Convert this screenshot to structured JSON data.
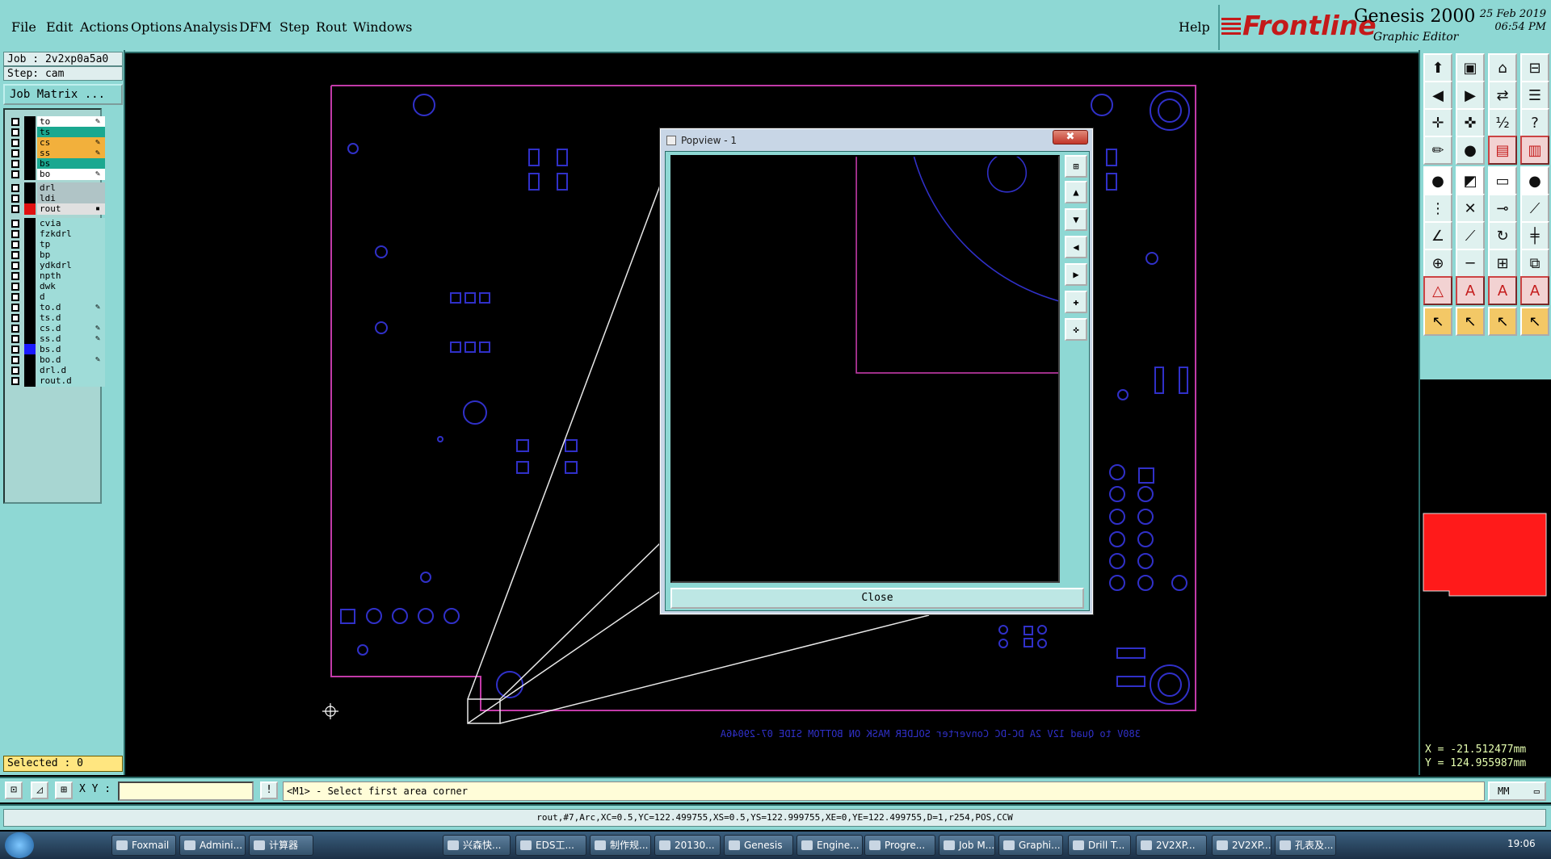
{
  "menubar": {
    "items": [
      "File",
      "Edit",
      "Actions",
      "Options",
      "Analysis",
      "DFM",
      "Step",
      "Rout",
      "Windows"
    ],
    "help": "Help"
  },
  "brand": {
    "logo": "Frontline",
    "product": "Genesis 2000",
    "subtitle": "Graphic Editor",
    "date": "25 Feb 2019",
    "time": "06:54 PM"
  },
  "left": {
    "job": "Job : 2v2xp0a5a0",
    "step": "Step: cam",
    "job_matrix": "Job Matrix ...",
    "layers": [
      {
        "name": "to",
        "color": "#ffffff",
        "swatch": "#000000",
        "flag": "✎"
      },
      {
        "name": "ts",
        "color": "#1aa890",
        "swatch": "#000000",
        "flag": ""
      },
      {
        "name": "cs",
        "color": "#f2b03c",
        "swatch": "#000000",
        "flag": "✎"
      },
      {
        "name": "ss",
        "color": "#f2b03c",
        "swatch": "#000000",
        "flag": "✎"
      },
      {
        "name": "bs",
        "color": "#1aa890",
        "swatch": "#000000",
        "flag": ""
      },
      {
        "name": "bo",
        "color": "#ffffff",
        "swatch": "#000000",
        "flag": "✎"
      },
      {
        "name": "drl",
        "color": "#b0c4c6",
        "swatch": "#000000",
        "flag": ""
      },
      {
        "name": "ldi",
        "color": "#b0c4c6",
        "swatch": "#000000",
        "flag": ""
      },
      {
        "name": "rout",
        "color": "#e0e0e0",
        "swatch": "#e01010",
        "flag": "▪"
      },
      {
        "name": "cvia",
        "color": "#9fdcd8",
        "swatch": "#000000",
        "flag": ""
      },
      {
        "name": "fzkdrl",
        "color": "#9fdcd8",
        "swatch": "#000000",
        "flag": ""
      },
      {
        "name": "tp",
        "color": "#9fdcd8",
        "swatch": "#000000",
        "flag": ""
      },
      {
        "name": "bp",
        "color": "#9fdcd8",
        "swatch": "#000000",
        "flag": ""
      },
      {
        "name": "ydkdrl",
        "color": "#9fdcd8",
        "swatch": "#000000",
        "flag": ""
      },
      {
        "name": "npth",
        "color": "#9fdcd8",
        "swatch": "#000000",
        "flag": ""
      },
      {
        "name": "dwk",
        "color": "#9fdcd8",
        "swatch": "#000000",
        "flag": ""
      },
      {
        "name": "d",
        "color": "#9fdcd8",
        "swatch": "#000000",
        "flag": ""
      },
      {
        "name": "to.d",
        "color": "#9fdcd8",
        "swatch": "#000000",
        "flag": "✎"
      },
      {
        "name": "ts.d",
        "color": "#9fdcd8",
        "swatch": "#000000",
        "flag": ""
      },
      {
        "name": "cs.d",
        "color": "#9fdcd8",
        "swatch": "#000000",
        "flag": "✎"
      },
      {
        "name": "ss.d",
        "color": "#9fdcd8",
        "swatch": "#000000",
        "flag": "✎"
      },
      {
        "name": "bs.d",
        "color": "#9fdcd8",
        "swatch": "#1a1aff",
        "flag": ""
      },
      {
        "name": "bo.d",
        "color": "#9fdcd8",
        "swatch": "#000000",
        "flag": "✎"
      },
      {
        "name": "drl.d",
        "color": "#9fdcd8",
        "swatch": "#000000",
        "flag": ""
      },
      {
        "name": "rout.d",
        "color": "#9fdcd8",
        "swatch": "#000000",
        "flag": ""
      }
    ],
    "selected": "Selected : 0"
  },
  "right": {
    "coord_x": "X = -21.512477mm",
    "coord_y": "Y = 124.955987mm"
  },
  "canvas": {
    "bottom_text": "380V to Quad 12V 2A DC-DC Converter SOLDER MASK ON BOTTOM SIDE 07-29046A"
  },
  "popview": {
    "title": "Popview - 1",
    "close": "Close",
    "close_x": "✖"
  },
  "cmd": {
    "xy_label": "X Y :",
    "xy_value": "",
    "prompt": "<M1> - Select first area corner",
    "units": "MM"
  },
  "status": {
    "text": "rout,#7,Arc,XC=0.5,YC=122.499755,XS=0.5,YS=122.999755,XE=0,YE=122.499755,D=1,r254,POS,CCW"
  },
  "taskbar": {
    "items": [
      "Foxmail",
      "Admini...",
      "计算器",
      "兴森快...",
      "EDS工...",
      "制作规...",
      "20130...",
      "Genesis",
      "Engine...",
      "Progre...",
      "Job M...",
      "Graphi...",
      "Drill T...",
      "2V2XP...",
      "2V2XP...",
      "孔表及..."
    ],
    "clock": "19:06"
  }
}
